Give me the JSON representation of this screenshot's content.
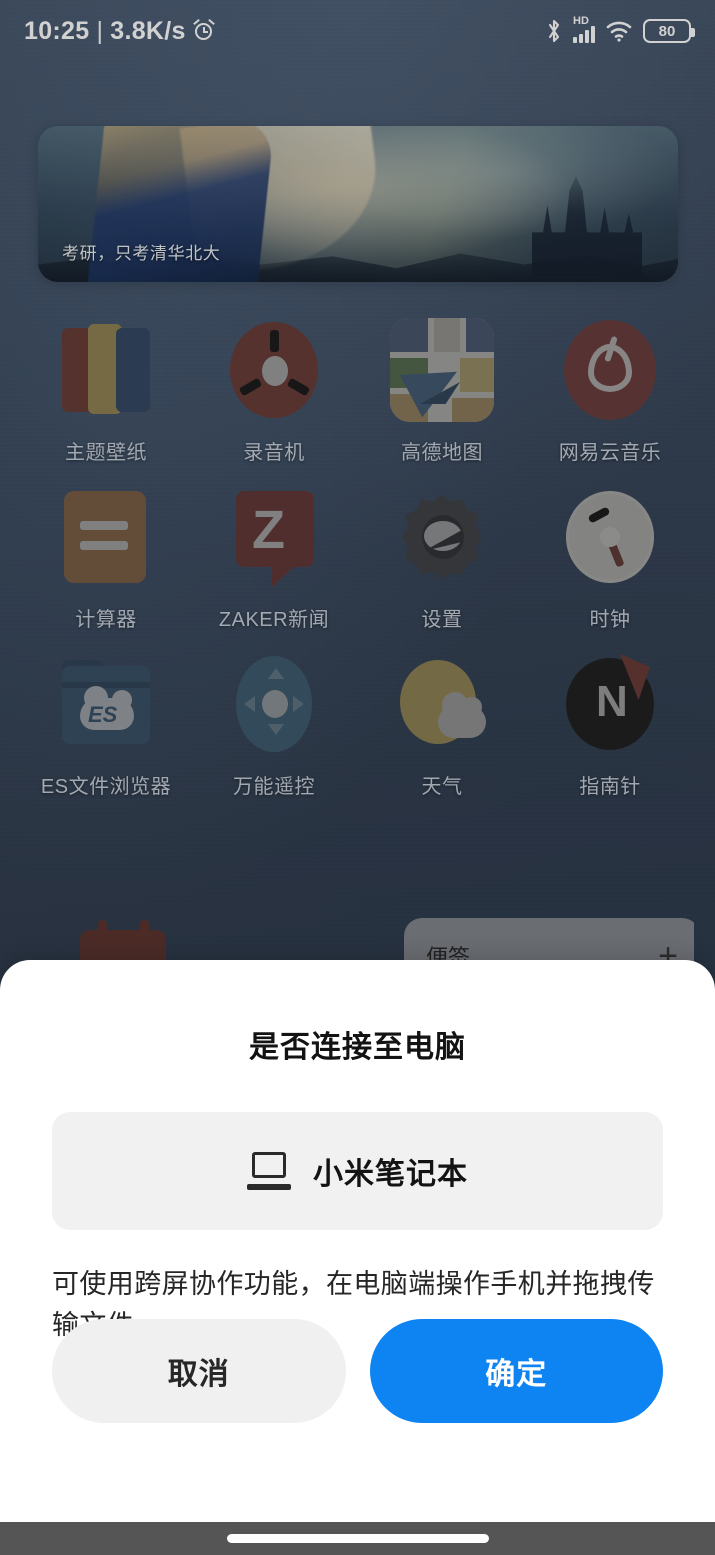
{
  "statusbar": {
    "time": "10:25",
    "separator": "|",
    "network_speed": "3.8K/s",
    "alarm_icon": "alarm-clock-icon",
    "bluetooth_icon": "bluetooth-icon",
    "network_type": "HD",
    "signal_icon": "cellular-signal-icon",
    "wifi_icon": "wifi-icon",
    "battery_level": "80"
  },
  "widget_banner": {
    "caption": "考研，只考清华北大"
  },
  "apps": [
    {
      "label": "主题壁纸",
      "icon": "theme-wallpaper-icon"
    },
    {
      "label": "录音机",
      "icon": "recorder-icon"
    },
    {
      "label": "高德地图",
      "icon": "amap-icon"
    },
    {
      "label": "网易云音乐",
      "icon": "netease-music-icon"
    },
    {
      "label": "计算器",
      "icon": "calculator-icon"
    },
    {
      "label": "ZAKER新闻",
      "icon": "zaker-news-icon"
    },
    {
      "label": "设置",
      "icon": "settings-gear-icon"
    },
    {
      "label": "时钟",
      "icon": "clock-icon"
    },
    {
      "label": "ES文件浏览器",
      "icon": "es-file-explorer-icon"
    },
    {
      "label": "万能遥控",
      "icon": "universal-remote-icon"
    },
    {
      "label": "天气",
      "icon": "weather-icon"
    },
    {
      "label": "指南针",
      "icon": "compass-icon"
    }
  ],
  "notes_widget": {
    "title": "便签",
    "add_label": "+"
  },
  "dialog": {
    "title": "是否连接至电脑",
    "device": {
      "name": "小米笔记本",
      "icon": "laptop-icon"
    },
    "description": "可使用跨屏协作功能，在电脑端操作手机并拖拽传输文件",
    "cancel_label": "取消",
    "confirm_label": "确定",
    "confirm_color": "#0d84f2",
    "cancel_color": "#f0f0f0"
  },
  "navbar": {
    "home_indicator": "home-indicator"
  }
}
